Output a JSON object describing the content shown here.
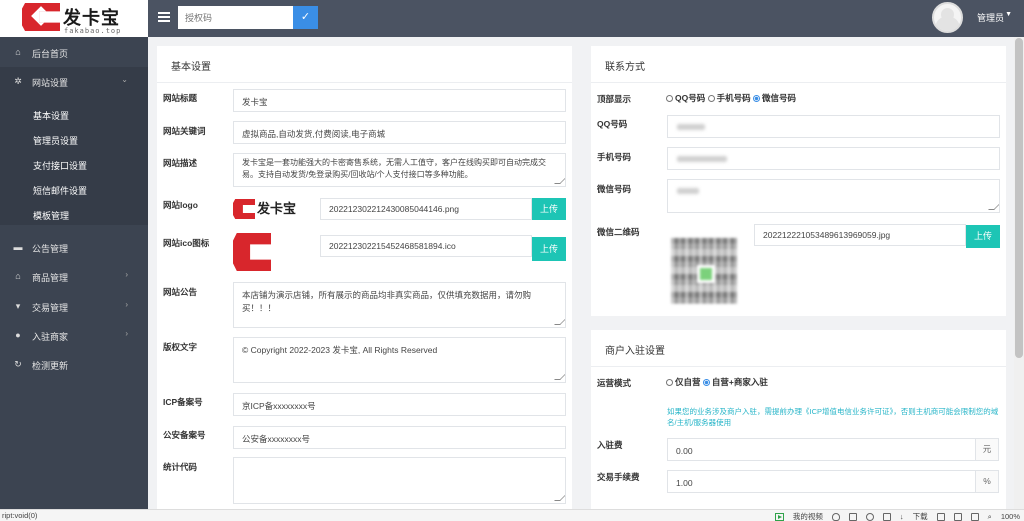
{
  "brand": {
    "name": "发卡宝",
    "sub": "fakabao.top"
  },
  "topbar": {
    "auth_placeholder": "授权码",
    "admin_name": "管理员"
  },
  "sidebar": {
    "items": [
      {
        "label": "后台首页",
        "icon": "home-icon"
      },
      {
        "label": "网站设置",
        "icon": "gear-icon"
      },
      {
        "label": "公告管理",
        "icon": "megaphone-icon"
      },
      {
        "label": "商品管理",
        "icon": "shop-icon"
      },
      {
        "label": "交易管理",
        "icon": "cart-icon"
      },
      {
        "label": "入驻商家",
        "icon": "user-icon"
      },
      {
        "label": "检测更新",
        "icon": "refresh-icon"
      }
    ],
    "sub_items": [
      "基本设置",
      "管理员设置",
      "支付接口设置",
      "短信邮件设置",
      "模板管理"
    ]
  },
  "basic": {
    "title": "基本设置",
    "site_title_label": "网站标题",
    "site_title_value": "发卡宝",
    "keywords_label": "网站关键词",
    "keywords_value": "虚拟商品,自动发货,付费阅读,电子商城",
    "desc_label": "网站描述",
    "desc_value": "发卡宝是一套功能强大的卡密寄售系统，无需人工值守，客户在线购买即可自动完成交易。支持自动发货/免登录购买/回收站/个人支付接口等多种功能。",
    "logo_label": "网站logo",
    "logo_file": "20221230221243008504414​6.png",
    "ico_label": "网站ico图标",
    "ico_file": "20221230221545246858189​4.ico",
    "upload": "上传",
    "notice_label": "网站公告",
    "notice_value": "本店铺为演示店铺，所有展示的商品均非真实商品，仅供填充数据用，请勿购买！！！",
    "copyright_label": "版权文字",
    "copyright_value": "© Copyright 2022-2023 发卡宝, All Rights Reserved",
    "icp_label": "ICP备案号",
    "icp_value": "京ICP备xxxxxxxx号",
    "police_label": "公安备案号",
    "police_value": "公安备xxxxxxxx号",
    "stats_label": "统计代码"
  },
  "contact": {
    "title": "联系方式",
    "top_display_label": "顶部显示",
    "options": [
      "QQ号码",
      "手机号码",
      "微信号码"
    ],
    "qq_label": "QQ号码",
    "phone_label": "手机号码",
    "wechat_label": "微信号码",
    "wxqr_label": "微信二维码",
    "wxqr_file": "20221222105348961396905​9.jpg",
    "upload": "上传"
  },
  "merchant": {
    "title": "商户入驻设置",
    "mode_label": "运营模式",
    "mode_options": [
      "仅自营",
      "自营+商家入驻"
    ],
    "hint": "如果您的业务涉及商户入驻，需提前办理《ICP增值电信业务许可证》，否则主机商可能会限制您的域名/主机/服务器使用",
    "fee_label": "入驻费",
    "fee_value": "0.00",
    "fee_unit": "元",
    "rate_label": "交易手续费",
    "rate_value": "1.00",
    "rate_unit": "%"
  },
  "statusbar": {
    "left": "ript:void(0)",
    "video": "我的视频",
    "download": "下载",
    "zoom": "100%"
  }
}
